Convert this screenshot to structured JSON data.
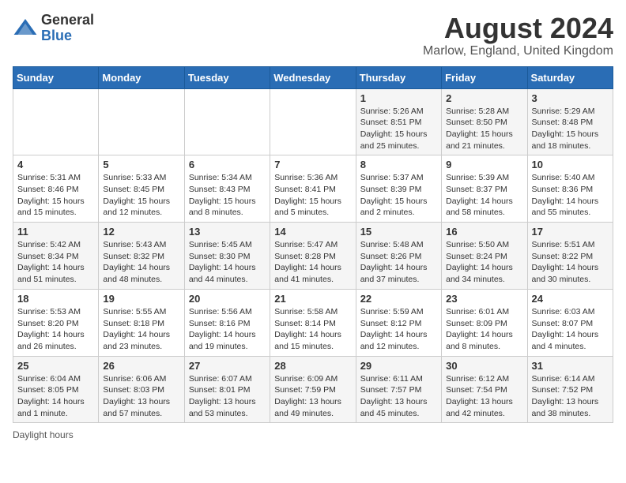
{
  "header": {
    "logo_general": "General",
    "logo_blue": "Blue",
    "main_title": "August 2024",
    "subtitle": "Marlow, England, United Kingdom"
  },
  "days_of_week": [
    "Sunday",
    "Monday",
    "Tuesday",
    "Wednesday",
    "Thursday",
    "Friday",
    "Saturday"
  ],
  "footer": {
    "daylight_hours": "Daylight hours"
  },
  "weeks": [
    [
      {
        "day": "",
        "sunrise": "",
        "sunset": "",
        "daylight": ""
      },
      {
        "day": "",
        "sunrise": "",
        "sunset": "",
        "daylight": ""
      },
      {
        "day": "",
        "sunrise": "",
        "sunset": "",
        "daylight": ""
      },
      {
        "day": "",
        "sunrise": "",
        "sunset": "",
        "daylight": ""
      },
      {
        "day": "1",
        "sunrise": "Sunrise: 5:26 AM",
        "sunset": "Sunset: 8:51 PM",
        "daylight": "Daylight: 15 hours and 25 minutes."
      },
      {
        "day": "2",
        "sunrise": "Sunrise: 5:28 AM",
        "sunset": "Sunset: 8:50 PM",
        "daylight": "Daylight: 15 hours and 21 minutes."
      },
      {
        "day": "3",
        "sunrise": "Sunrise: 5:29 AM",
        "sunset": "Sunset: 8:48 PM",
        "daylight": "Daylight: 15 hours and 18 minutes."
      }
    ],
    [
      {
        "day": "4",
        "sunrise": "Sunrise: 5:31 AM",
        "sunset": "Sunset: 8:46 PM",
        "daylight": "Daylight: 15 hours and 15 minutes."
      },
      {
        "day": "5",
        "sunrise": "Sunrise: 5:33 AM",
        "sunset": "Sunset: 8:45 PM",
        "daylight": "Daylight: 15 hours and 12 minutes."
      },
      {
        "day": "6",
        "sunrise": "Sunrise: 5:34 AM",
        "sunset": "Sunset: 8:43 PM",
        "daylight": "Daylight: 15 hours and 8 minutes."
      },
      {
        "day": "7",
        "sunrise": "Sunrise: 5:36 AM",
        "sunset": "Sunset: 8:41 PM",
        "daylight": "Daylight: 15 hours and 5 minutes."
      },
      {
        "day": "8",
        "sunrise": "Sunrise: 5:37 AM",
        "sunset": "Sunset: 8:39 PM",
        "daylight": "Daylight: 15 hours and 2 minutes."
      },
      {
        "day": "9",
        "sunrise": "Sunrise: 5:39 AM",
        "sunset": "Sunset: 8:37 PM",
        "daylight": "Daylight: 14 hours and 58 minutes."
      },
      {
        "day": "10",
        "sunrise": "Sunrise: 5:40 AM",
        "sunset": "Sunset: 8:36 PM",
        "daylight": "Daylight: 14 hours and 55 minutes."
      }
    ],
    [
      {
        "day": "11",
        "sunrise": "Sunrise: 5:42 AM",
        "sunset": "Sunset: 8:34 PM",
        "daylight": "Daylight: 14 hours and 51 minutes."
      },
      {
        "day": "12",
        "sunrise": "Sunrise: 5:43 AM",
        "sunset": "Sunset: 8:32 PM",
        "daylight": "Daylight: 14 hours and 48 minutes."
      },
      {
        "day": "13",
        "sunrise": "Sunrise: 5:45 AM",
        "sunset": "Sunset: 8:30 PM",
        "daylight": "Daylight: 14 hours and 44 minutes."
      },
      {
        "day": "14",
        "sunrise": "Sunrise: 5:47 AM",
        "sunset": "Sunset: 8:28 PM",
        "daylight": "Daylight: 14 hours and 41 minutes."
      },
      {
        "day": "15",
        "sunrise": "Sunrise: 5:48 AM",
        "sunset": "Sunset: 8:26 PM",
        "daylight": "Daylight: 14 hours and 37 minutes."
      },
      {
        "day": "16",
        "sunrise": "Sunrise: 5:50 AM",
        "sunset": "Sunset: 8:24 PM",
        "daylight": "Daylight: 14 hours and 34 minutes."
      },
      {
        "day": "17",
        "sunrise": "Sunrise: 5:51 AM",
        "sunset": "Sunset: 8:22 PM",
        "daylight": "Daylight: 14 hours and 30 minutes."
      }
    ],
    [
      {
        "day": "18",
        "sunrise": "Sunrise: 5:53 AM",
        "sunset": "Sunset: 8:20 PM",
        "daylight": "Daylight: 14 hours and 26 minutes."
      },
      {
        "day": "19",
        "sunrise": "Sunrise: 5:55 AM",
        "sunset": "Sunset: 8:18 PM",
        "daylight": "Daylight: 14 hours and 23 minutes."
      },
      {
        "day": "20",
        "sunrise": "Sunrise: 5:56 AM",
        "sunset": "Sunset: 8:16 PM",
        "daylight": "Daylight: 14 hours and 19 minutes."
      },
      {
        "day": "21",
        "sunrise": "Sunrise: 5:58 AM",
        "sunset": "Sunset: 8:14 PM",
        "daylight": "Daylight: 14 hours and 15 minutes."
      },
      {
        "day": "22",
        "sunrise": "Sunrise: 5:59 AM",
        "sunset": "Sunset: 8:12 PM",
        "daylight": "Daylight: 14 hours and 12 minutes."
      },
      {
        "day": "23",
        "sunrise": "Sunrise: 6:01 AM",
        "sunset": "Sunset: 8:09 PM",
        "daylight": "Daylight: 14 hours and 8 minutes."
      },
      {
        "day": "24",
        "sunrise": "Sunrise: 6:03 AM",
        "sunset": "Sunset: 8:07 PM",
        "daylight": "Daylight: 14 hours and 4 minutes."
      }
    ],
    [
      {
        "day": "25",
        "sunrise": "Sunrise: 6:04 AM",
        "sunset": "Sunset: 8:05 PM",
        "daylight": "Daylight: 14 hours and 1 minute."
      },
      {
        "day": "26",
        "sunrise": "Sunrise: 6:06 AM",
        "sunset": "Sunset: 8:03 PM",
        "daylight": "Daylight: 13 hours and 57 minutes."
      },
      {
        "day": "27",
        "sunrise": "Sunrise: 6:07 AM",
        "sunset": "Sunset: 8:01 PM",
        "daylight": "Daylight: 13 hours and 53 minutes."
      },
      {
        "day": "28",
        "sunrise": "Sunrise: 6:09 AM",
        "sunset": "Sunset: 7:59 PM",
        "daylight": "Daylight: 13 hours and 49 minutes."
      },
      {
        "day": "29",
        "sunrise": "Sunrise: 6:11 AM",
        "sunset": "Sunset: 7:57 PM",
        "daylight": "Daylight: 13 hours and 45 minutes."
      },
      {
        "day": "30",
        "sunrise": "Sunrise: 6:12 AM",
        "sunset": "Sunset: 7:54 PM",
        "daylight": "Daylight: 13 hours and 42 minutes."
      },
      {
        "day": "31",
        "sunrise": "Sunrise: 6:14 AM",
        "sunset": "Sunset: 7:52 PM",
        "daylight": "Daylight: 13 hours and 38 minutes."
      }
    ]
  ]
}
